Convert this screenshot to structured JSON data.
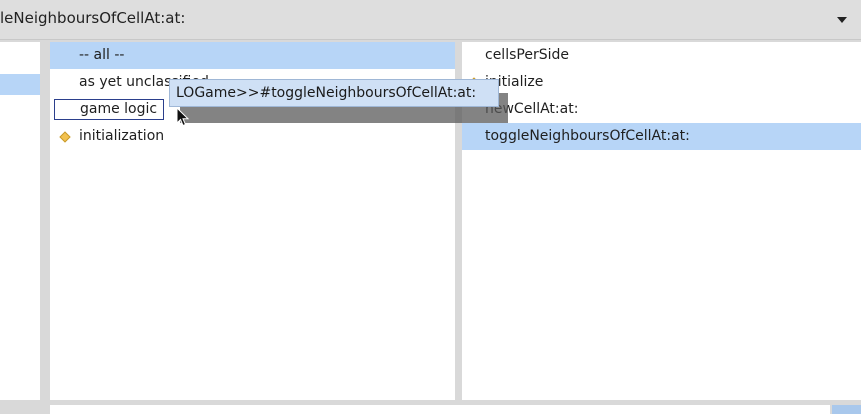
{
  "selector": {
    "text": "leNeighboursOfCellAt:at:"
  },
  "protocols": [
    {
      "label": "-- all --"
    },
    {
      "label": "as yet unclassified"
    },
    {
      "label": "game logic"
    },
    {
      "label": "initialization"
    }
  ],
  "methods": [
    {
      "label": "cellsPerSide"
    },
    {
      "label": "initialize"
    },
    {
      "label": "newCellAt:at:"
    },
    {
      "label": "toggleNeighboursOfCellAt:at:"
    }
  ],
  "tooltip": {
    "text": "LOGame>>#toggleNeighboursOfCellAt:at:"
  },
  "colors": {
    "selection": "#b7d5f7",
    "diamond": "#f2c14e",
    "tooltip_bg": "#cfe0f5"
  }
}
